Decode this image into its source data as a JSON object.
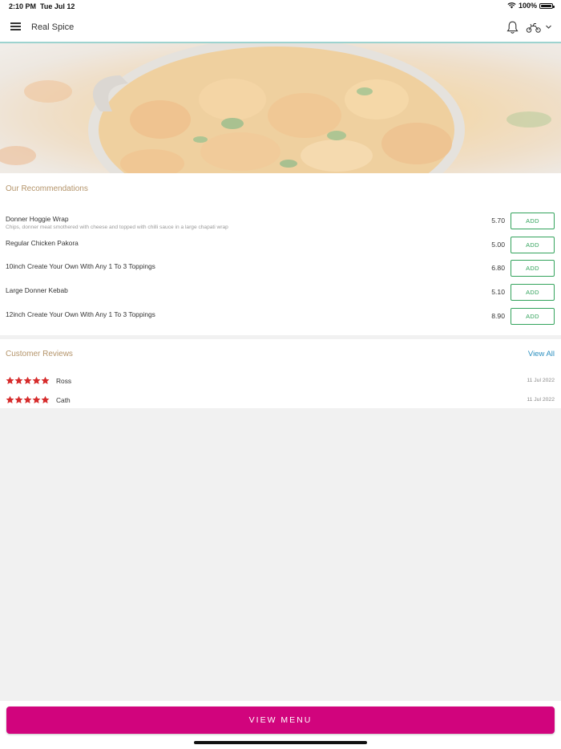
{
  "status_bar": {
    "time": "2:10 PM",
    "date": "Tue Jul 12",
    "battery": "100%",
    "icons": [
      "wifi-icon",
      "battery-icon"
    ]
  },
  "header": {
    "title": "Real Spice",
    "icons": [
      "hamburger-menu-icon",
      "bell-icon",
      "delivery-icon",
      "chevron-down-icon"
    ]
  },
  "recommendations": {
    "title": "Our Recommendations",
    "add_label": "ADD",
    "items": [
      {
        "name": "Donner Hoggie Wrap",
        "description": "Chips, donner meat smothered with cheese and topped with chilli sauce in a large chapati wrap",
        "price": "5.70"
      },
      {
        "name": "Regular Chicken Pakora",
        "description": "",
        "price": "5.00"
      },
      {
        "name": "10inch Create Your Own With Any 1 To 3 Toppings",
        "description": "",
        "price": "6.80"
      },
      {
        "name": "Large Donner Kebab",
        "description": "",
        "price": "5.10"
      },
      {
        "name": "12inch Create Your Own With Any 1 To 3 Toppings",
        "description": "",
        "price": "8.90"
      }
    ]
  },
  "reviews": {
    "title": "Customer Reviews",
    "view_all_label": "View All",
    "items": [
      {
        "name": "Ross",
        "rating": 5,
        "date": "11 Jul 2022"
      },
      {
        "name": "Cath",
        "rating": 5,
        "date": "11 Jul 2022"
      }
    ]
  },
  "footer": {
    "view_menu_label": "VIEW MENU"
  },
  "colors": {
    "accent": "#d1047d",
    "add_button": "#33a35c",
    "section_title": "#b4946a",
    "link": "#2a8fbf",
    "star": "#d62b2b",
    "header_border": "#9dd3cf"
  }
}
